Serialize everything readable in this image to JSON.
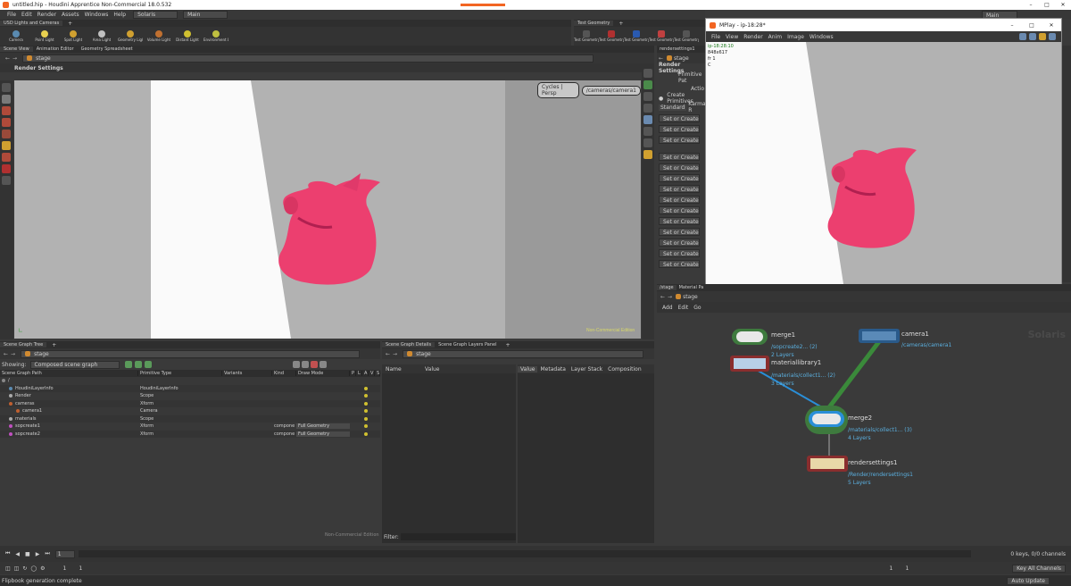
{
  "titlebar": {
    "title": "untitled.hip - Houdini Apprentice Non-Commercial 18.0.532",
    "min": "–",
    "max": "□",
    "close": "✕"
  },
  "menubar": {
    "items": [
      "File",
      "Edit",
      "Render",
      "Assets",
      "Windows",
      "Help"
    ],
    "desktop": "Solaris",
    "main": "Main",
    "right_main": "Main"
  },
  "shelf": {
    "tab_left": "USD Lights and Cameras",
    "tab_right": "Test Geometry",
    "tools": [
      "Camera",
      "Point Light",
      "Spot Light",
      "Area Light",
      "Geometry Light",
      "Volume Light",
      "Distant Light",
      "Environment Light"
    ],
    "right_tools": [
      "Test Geometry: C...",
      "Test Geometry: P...",
      "Test Geometry: R...",
      "Test Geometry: S...",
      "Test Geometry: T..."
    ]
  },
  "viewer": {
    "tabs": [
      "Scene View",
      "Animation Editor",
      "Geometry Spreadsheet"
    ],
    "path": "stage",
    "title": "Render Settings",
    "renderer": "Cycles | Persp",
    "camera": "/cameras/camera1",
    "watermark": "Non-Commercial Edition"
  },
  "params": {
    "path": "stage",
    "title": "Render Settings",
    "labels": [
      "Primitive Pat",
      "Actio"
    ],
    "create_primitives": "Create Primitives",
    "tabs": [
      "Standard",
      "Karma R"
    ],
    "button": "Set or Create",
    "count": 14
  },
  "scene_tree": {
    "tab": "Scene Graph Tree",
    "path": "stage",
    "showing_label": "Showing:",
    "showing_value": "Composed scene graph",
    "columns": [
      "Scene Graph Path",
      "Primitive Type",
      "Variants",
      "Kind",
      "Draw Mode",
      "P",
      "L",
      "A",
      "V",
      "S"
    ],
    "rows": [
      {
        "name": "/",
        "type": "",
        "kind": "",
        "draw": ""
      },
      {
        "name": "HoudiniLayerInfo",
        "type": "HoudiniLayerInfo",
        "kind": "",
        "draw": ""
      },
      {
        "name": "Render",
        "type": "Scope",
        "kind": "",
        "draw": ""
      },
      {
        "name": "cameras",
        "type": "Xform",
        "kind": "",
        "draw": ""
      },
      {
        "name": "camera1",
        "type": "Camera",
        "kind": "",
        "draw": ""
      },
      {
        "name": "materials",
        "type": "Scope",
        "kind": "",
        "draw": ""
      },
      {
        "name": "sopcreate1",
        "type": "Xform",
        "kind": "compone",
        "draw": "Full Geometry"
      },
      {
        "name": "sopcreate2",
        "type": "Xform",
        "kind": "compone",
        "draw": "Full Geometry"
      }
    ],
    "watermark": "Non-Commercial Edition"
  },
  "scene_details": {
    "tabs": [
      "Scene Graph Details",
      "Scene Graph Layers Panel"
    ],
    "path": "stage",
    "columns": [
      "Name",
      "Value"
    ],
    "right_tabs": [
      "Value",
      "Metadata",
      "Layer Stack",
      "Composition"
    ],
    "filter": "Filter:"
  },
  "network": {
    "tabs": [
      "/stage",
      "Material Pa"
    ],
    "path": "stage",
    "menu": [
      "Add",
      "Edit",
      "Go"
    ],
    "watermark": "Solaris",
    "nodes": [
      {
        "name": "merge1",
        "info1": "/sopcreate2... (2)",
        "info2": "2 Layers"
      },
      {
        "name": "materiallibrary1",
        "info1": "/materials/collect1... (2)",
        "info2": "3 Layers"
      },
      {
        "name": "camera1",
        "info1": "/cameras/camera1",
        "info2": ""
      },
      {
        "name": "merge2",
        "info1": "/materials/collect1... (3)",
        "info2": "4 Layers"
      },
      {
        "name": "rendersettings1",
        "info1": "/Render/rendersettings1",
        "info2": "5 Layers"
      }
    ]
  },
  "mplay": {
    "title": "MPlay - ip-18:28*",
    "menu": [
      "File",
      "View",
      "Render",
      "Anim",
      "Image",
      "Windows"
    ],
    "info": [
      "ip-18:28:10",
      "848x617",
      "fr 1",
      "C"
    ],
    "frame": "1",
    "fps": "24",
    "start": "1",
    "end": "1"
  },
  "timeline": {
    "frame": "1",
    "start1": "1",
    "start2": "1",
    "end1": "1",
    "end2": "1",
    "keys": "0 keys, 0/0 channels",
    "key_all": "Key All Channels"
  },
  "status": {
    "message": "Flipbook generation complete",
    "update": "Auto Update"
  }
}
